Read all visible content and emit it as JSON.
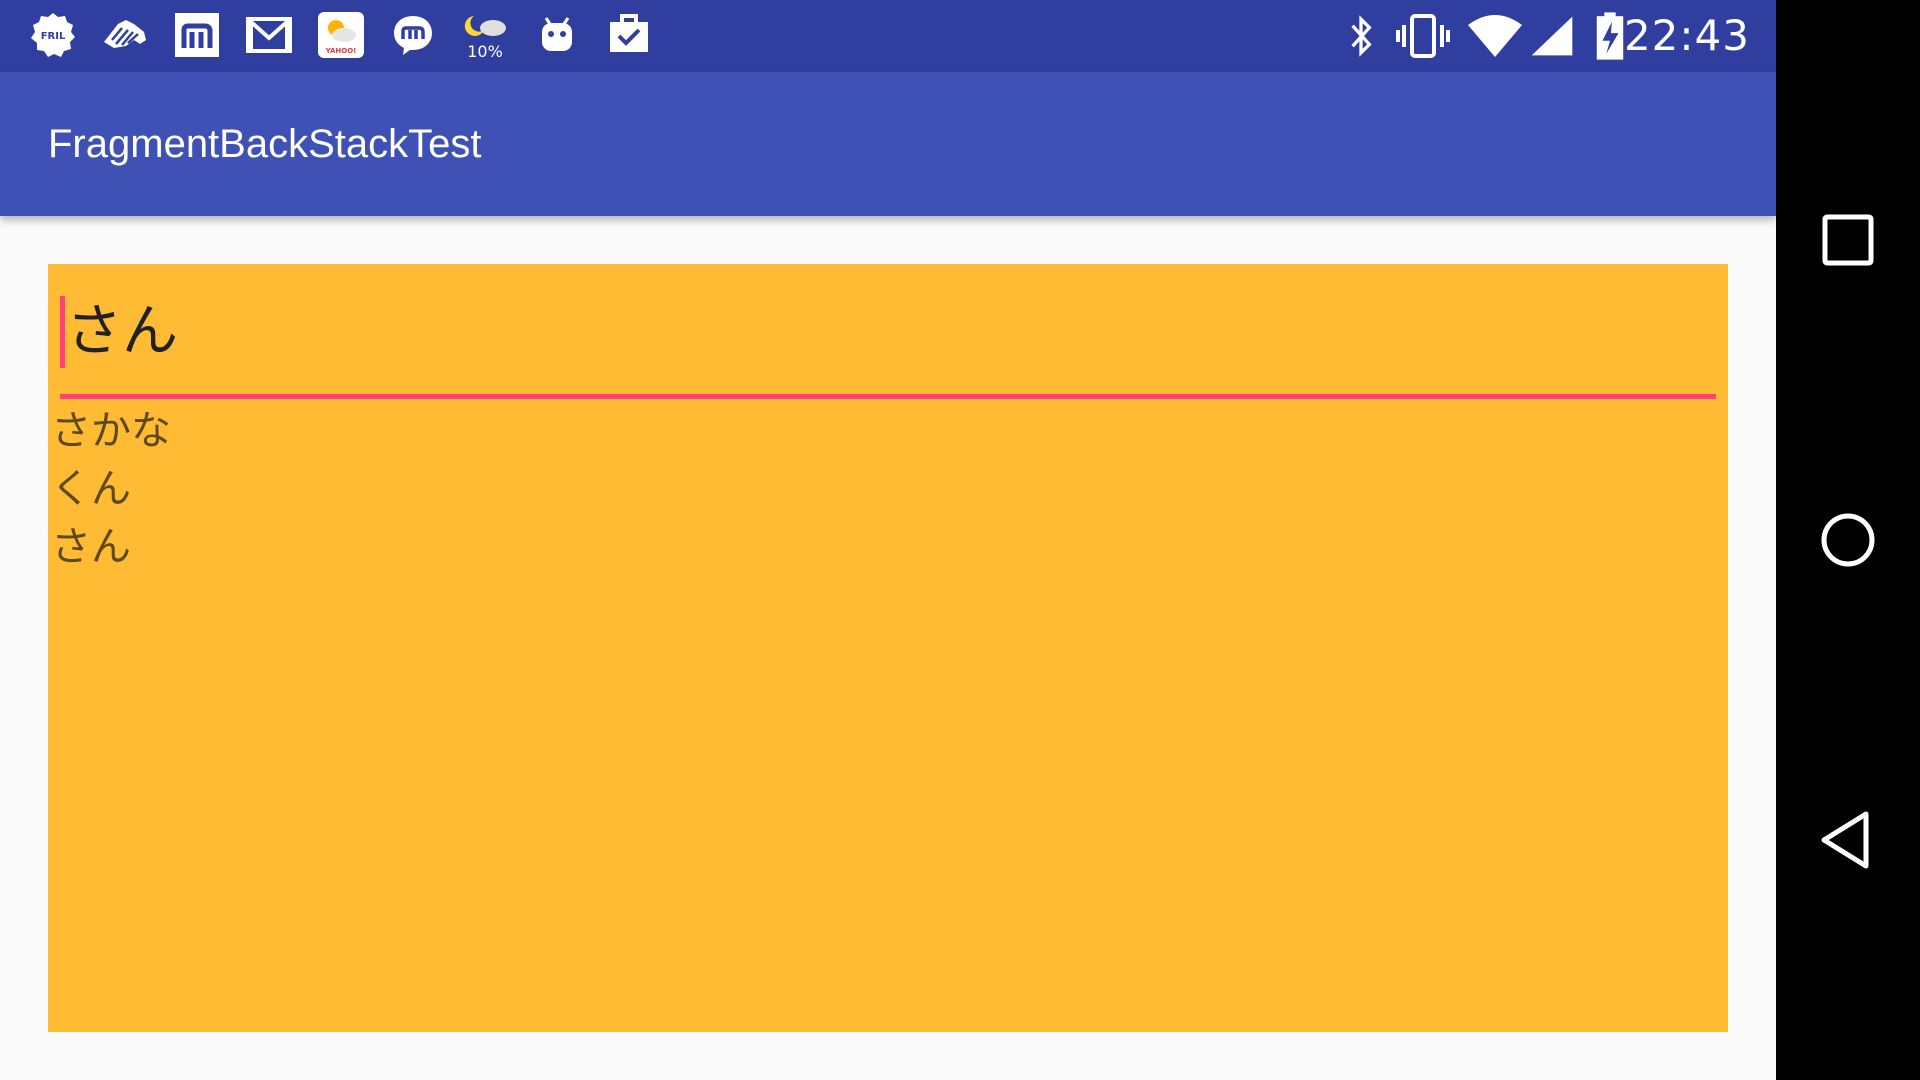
{
  "status_bar": {
    "time": "22:43",
    "notification_icons": [
      {
        "name": "fril-icon",
        "label": "FRIL"
      },
      {
        "name": "zebra-icon",
        "label": ""
      },
      {
        "name": "m-app-icon",
        "label": ""
      },
      {
        "name": "gmail-icon",
        "label": ""
      },
      {
        "name": "yahoo-weather-icon",
        "label": "YAHOO!"
      },
      {
        "name": "messenger-icon",
        "label": ""
      },
      {
        "name": "weather-moon-cloud-icon",
        "label": "10%"
      },
      {
        "name": "android-icon",
        "label": ""
      },
      {
        "name": "clipboard-check-icon",
        "label": ""
      }
    ],
    "system_icons": [
      "bluetooth-icon",
      "vibrate-icon",
      "wifi-icon",
      "signal-icon",
      "battery-charging-icon"
    ]
  },
  "app_bar": {
    "title": "FragmentBackStackTest"
  },
  "content": {
    "edit_text_value": "さん",
    "items": [
      "さかな",
      "くん",
      "さん"
    ]
  },
  "nav_bar": {
    "buttons": [
      "recent-apps-button",
      "home-button",
      "back-button"
    ]
  },
  "colors": {
    "status_bar": "#303f9f",
    "app_bar": "#3f51b5",
    "panel": "#ffbb33",
    "accent": "#ff4081",
    "background": "#fafafa",
    "nav_bar": "#000000"
  }
}
